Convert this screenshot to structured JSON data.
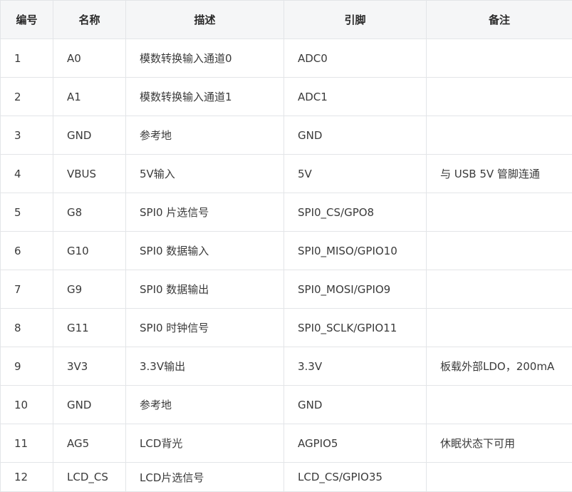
{
  "table": {
    "headers": [
      "编号",
      "名称",
      "描述",
      "引脚",
      "备注"
    ],
    "rows": [
      [
        "1",
        "A0",
        "模数转换输入通道0",
        "ADC0",
        ""
      ],
      [
        "2",
        "A1",
        "模数转换输入通道1",
        "ADC1",
        ""
      ],
      [
        "3",
        "GND",
        "参考地",
        "GND",
        ""
      ],
      [
        "4",
        "VBUS",
        "5V输入",
        "5V",
        "与 USB 5V 管脚连通"
      ],
      [
        "5",
        "G8",
        "SPI0 片选信号",
        "SPI0_CS/GPO8",
        ""
      ],
      [
        "6",
        "G10",
        "SPI0 数据输入",
        "SPI0_MISO/GPIO10",
        ""
      ],
      [
        "7",
        "G9",
        "SPI0 数据输出",
        "SPI0_MOSI/GPIO9",
        ""
      ],
      [
        "8",
        "G11",
        "SPI0 时钟信号",
        "SPI0_SCLK/GPIO11",
        ""
      ],
      [
        "9",
        "3V3",
        "3.3V输出",
        "3.3V",
        "板载外部LDO，200mA"
      ],
      [
        "10",
        "GND",
        "参考地",
        "GND",
        ""
      ],
      [
        "11",
        "AG5",
        "LCD背光",
        "AGPIO5",
        "休眠状态下可用"
      ],
      [
        "12",
        "LCD_CS",
        "LCD片选信号",
        "LCD_CS/GPIO35",
        ""
      ]
    ]
  }
}
